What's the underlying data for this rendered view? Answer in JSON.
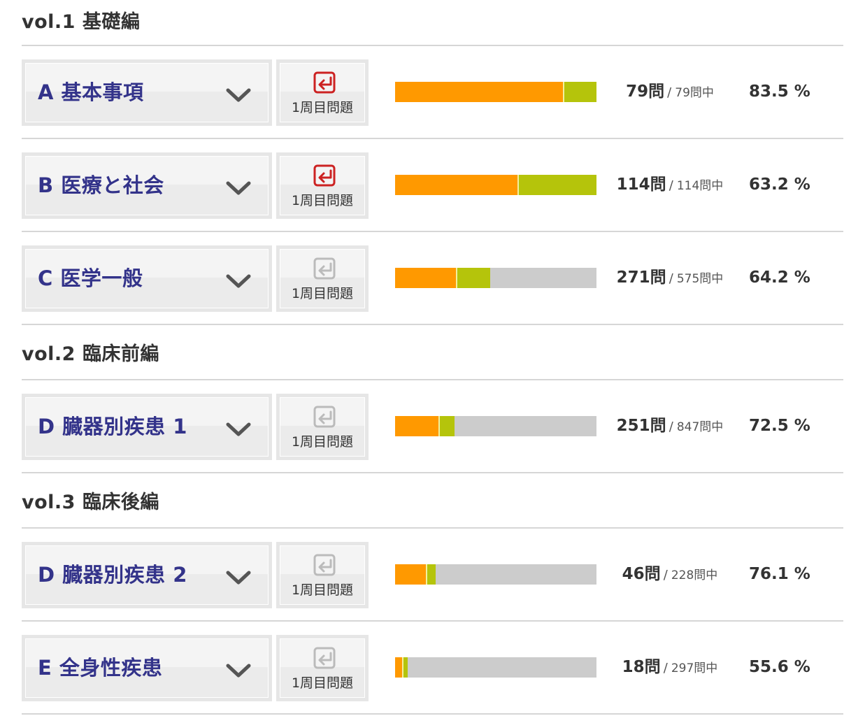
{
  "sections": [
    {
      "title": "vol.1 基礎編",
      "rows": [
        {
          "label": "A 基本事項",
          "round_label": "1周目問題",
          "round_active": true,
          "count": "79問",
          "sep": "/",
          "total": "79問中",
          "percent": "83.5 %",
          "progress_orange": 0.835,
          "progress_green": 0.165
        },
        {
          "label": "B 医療と社会",
          "round_label": "1周目問題",
          "round_active": true,
          "count": "114問",
          "sep": "/",
          "total": "114問中",
          "percent": "63.2 %",
          "progress_orange": 0.607,
          "progress_green": 0.393
        },
        {
          "label": "C 医学一般",
          "round_label": "1周目問題",
          "round_active": false,
          "count": "271問",
          "sep": "/",
          "total": "575問中",
          "percent": "64.2 %",
          "progress_orange": 0.302,
          "progress_green": 0.17
        }
      ]
    },
    {
      "title": "vol.2 臨床前編",
      "rows": [
        {
          "label": "D 臓器別疾患 1",
          "round_label": "1周目問題",
          "round_active": false,
          "count": "251問",
          "sep": "/",
          "total": "847問中",
          "percent": "72.5 %",
          "progress_orange": 0.215,
          "progress_green": 0.081
        }
      ]
    },
    {
      "title": "vol.3 臨床後編",
      "rows": [
        {
          "label": "D 臓器別疾患 2",
          "round_label": "1周目問題",
          "round_active": false,
          "count": "46問",
          "sep": "/",
          "total": "228問中",
          "percent": "76.1 %",
          "progress_orange": 0.153,
          "progress_green": 0.049
        },
        {
          "label": "E 全身性疾患",
          "round_label": "1周目問題",
          "round_active": false,
          "count": "18問",
          "sep": "/",
          "total": "297問中",
          "percent": "55.6 %",
          "progress_orange": 0.033,
          "progress_green": 0.028
        }
      ]
    }
  ],
  "colors": {
    "orange": "#ff9900",
    "green": "#b5c40b",
    "empty": "#cccccc",
    "label": "#33338a",
    "icon_active": "#cc2222",
    "icon_inactive": "#bbbbbb"
  },
  "icons": {
    "chevron": "chevron-down-icon",
    "round": "return-arrow-icon"
  }
}
